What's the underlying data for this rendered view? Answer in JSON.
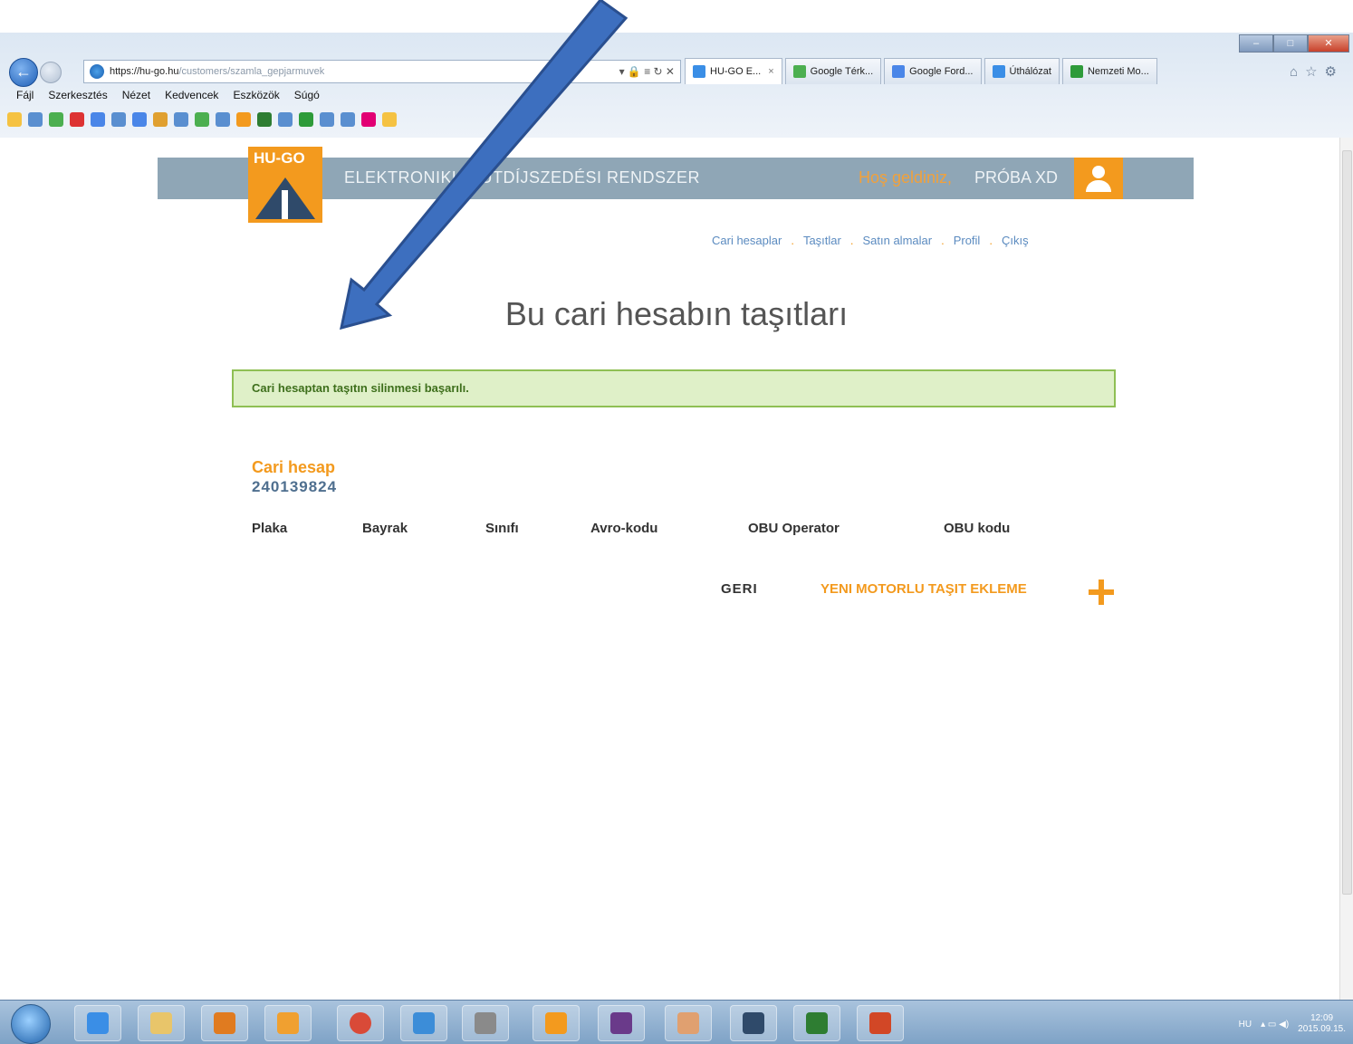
{
  "browser": {
    "url_host": "https://hu-go.hu",
    "url_path": "/customers/szamla_gepjarmuvek",
    "tabs": [
      {
        "label": "HU-GO E...",
        "color": "#3a8ee6"
      },
      {
        "label": "Google Térk...",
        "color": "#4caf50"
      },
      {
        "label": "Google Ford...",
        "color": "#4a86e8"
      },
      {
        "label": "Úthálózat",
        "color": "#3a8ee6"
      },
      {
        "label": "Nemzeti Mo...",
        "color": "#2e9b3a"
      }
    ],
    "tab_close": "×",
    "menu": [
      "Fájl",
      "Szerkesztés",
      "Nézet",
      "Kedvencek",
      "Eszközök",
      "Súgó"
    ]
  },
  "site": {
    "logo_text": "HU-GO",
    "system_title": "ELEKTRONIKUS ÚTDÍJSZEDÉSI RENDSZER",
    "welcome": "Hoş geldiniz,",
    "username": "PRÓBA XD",
    "nav": [
      "Cari hesaplar",
      "Taşıtlar",
      "Satın almalar",
      "Profil",
      "Çıkış"
    ],
    "nav_separator": "."
  },
  "page": {
    "title": "Bu cari hesabın taşıtları",
    "alert": "Cari hesaptan taşıtın silinmesi başarılı.",
    "account_label": "Cari hesap",
    "account_number": "240139824",
    "columns": [
      "Plaka",
      "Bayrak",
      "Sınıfı",
      "Avro-kodu",
      "OBU Operator",
      "OBU kodu"
    ],
    "back_label": "GERI",
    "new_vehicle_label": "YENI MOTORLU TAŞIT EKLEME"
  },
  "taskbar": {
    "lang": "HU",
    "time": "12:09",
    "date": "2015.09.15."
  },
  "colors": {
    "accent": "#f39a1e",
    "header_bar": "#8fa6b6",
    "link": "#5b8bc0",
    "success_bg": "#dff0c8",
    "success_border": "#8fbf54",
    "arrow": "#3d6fbf"
  }
}
